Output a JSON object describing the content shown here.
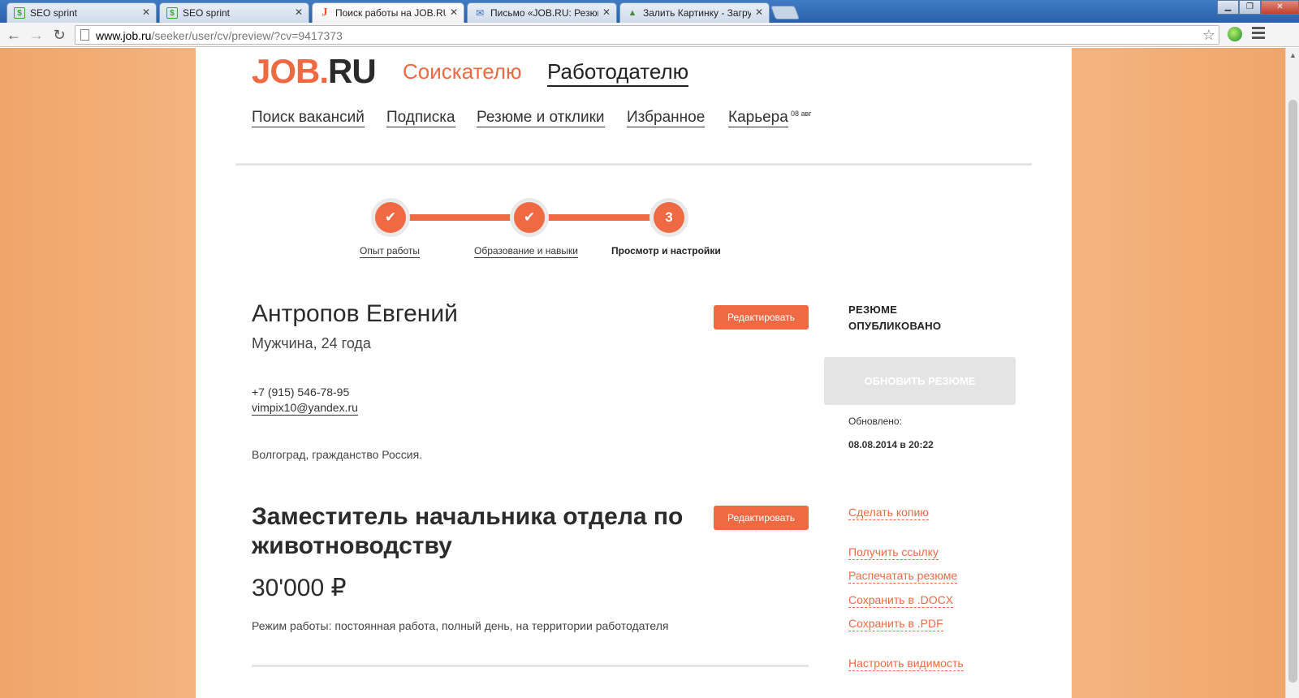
{
  "browser": {
    "tabs": [
      {
        "title": "SEO sprint",
        "icon": "seo-sprint-icon"
      },
      {
        "title": "SEO sprint",
        "icon": "seo-sprint-icon"
      },
      {
        "title": "Поиск работы на JOB.RU",
        "icon": "job-ru-icon"
      },
      {
        "title": "Письмо «JOB.RU: Резюме",
        "icon": "mail-icon"
      },
      {
        "title": "Залить Картинку - Загру",
        "icon": "image-icon"
      }
    ],
    "url_host": "www.job.ru",
    "url_path": "/seeker/user/cv/preview/?cv=9417373"
  },
  "site": {
    "logo_main": "JOB",
    "logo_dot": ".",
    "logo_ru": "RU",
    "nav_seeker": "Соискателю",
    "nav_employer": "Работодателю",
    "subnav": [
      "Поиск вакансий",
      "Подписка",
      "Резюме и отклики",
      "Избранное",
      "Карьера"
    ],
    "career_badge": "08 авг"
  },
  "steps": [
    {
      "label": "Опыт работы",
      "mark": "✔"
    },
    {
      "label": "Образование и навыки",
      "mark": "✔"
    },
    {
      "label": "Просмотр и настройки",
      "mark": "3"
    }
  ],
  "resume": {
    "name": "Антропов Евгений",
    "meta": "Мужчина, 24 года",
    "edit_label": "Редактировать",
    "phone": "+7 (915) 546-78-95",
    "email": "vimpix10@yandex.ru",
    "location": "Волгоград, гражданство Россия.",
    "position": "Заместитель начальника отдела по животноводству",
    "salary": "30'000 ₽",
    "work_mode": "Режим работы: постоянная работа, полный день, на территории работодателя"
  },
  "sidebar": {
    "status": "РЕЗЮМЕ ОПУБЛИКОВАНО",
    "update_button": "ОБНОВИТЬ РЕЗЮМЕ",
    "updated_label": "Обновлено:",
    "updated_value": "08.08.2014 в 20:22",
    "links": [
      "Сделать копию",
      "Получить ссылку",
      "Распечатать резюме",
      "Сохранить в .DOCX",
      "Сохранить в .PDF",
      "Настроить видимость"
    ]
  },
  "colors": {
    "accent": "#ef6a43",
    "background_orange": "#f4b37e"
  }
}
